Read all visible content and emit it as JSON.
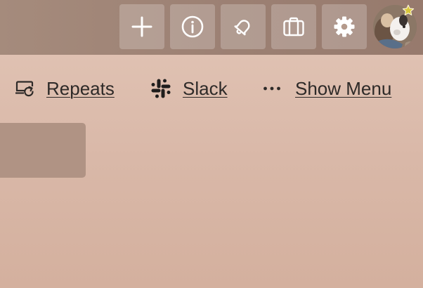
{
  "toolbar": {
    "buttons": [
      {
        "icon": "plus-icon"
      },
      {
        "icon": "info-icon"
      },
      {
        "icon": "bell-icon"
      },
      {
        "icon": "briefcase-icon"
      },
      {
        "icon": "gear-icon"
      }
    ]
  },
  "board_header": {
    "repeats_label": "Repeats",
    "slack_label": "Slack",
    "show_menu_label": "Show Menu"
  },
  "colors": {
    "toolbar_bg": "#9c8073",
    "page_bg": "#dcbcac",
    "text": "#2e2a28",
    "badge_star": "#d7c63a"
  }
}
